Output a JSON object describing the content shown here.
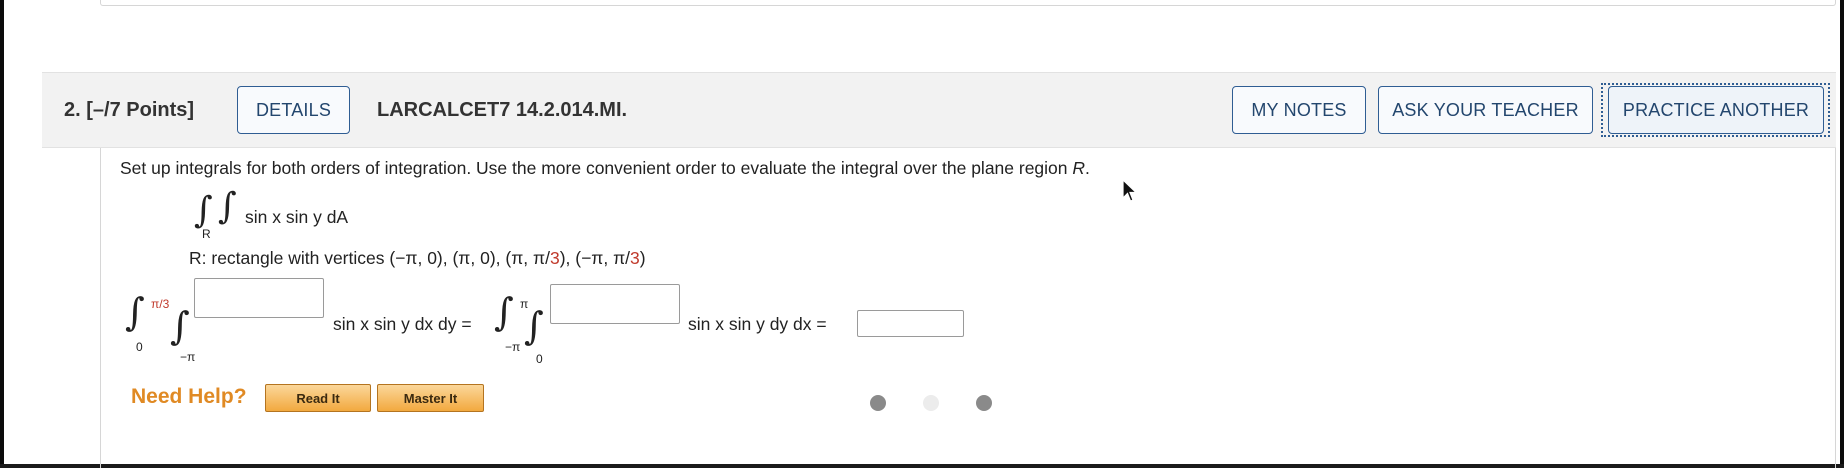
{
  "question": {
    "number_label": "2. [–/7 Points]",
    "details_label": "DETAILS",
    "code": "LARCALCET7 14.2.014.MI.",
    "my_notes_label": "MY NOTES",
    "ask_teacher_label": "ASK YOUR TEACHER",
    "practice_label": "PRACTICE ANOTHER"
  },
  "problem": {
    "instructions_main": "Set up integrals for both orders of integration. Use the more convenient order to evaluate the integral over the plane region ",
    "instructions_var": "R",
    "instructions_end": ".",
    "integral_sub": "R",
    "integrand": "sin x sin y dA",
    "region_prefix": "R: rectangle with vertices (−π, 0), (π, 0), (π, π/",
    "region_3a": "3",
    "region_mid": "), (−π, π/",
    "region_3b": "3",
    "region_end": ")"
  },
  "equation": {
    "outer1_upper": "π/3",
    "outer1_lower": "0",
    "inner1_lower": "−π",
    "integrand1": "sin x sin y dx dy =",
    "outer2_upper": "π",
    "outer2_lower": "−π",
    "inner2_lower": "0",
    "integrand2": "sin x sin y dy dx =",
    "inner1_upper_value": "",
    "inner2_upper_value": "",
    "answer_value": ""
  },
  "help": {
    "label": "Need Help?",
    "read_it": "Read It",
    "master_it": "Master It"
  },
  "colors": {
    "accent_blue": "#2f5d93",
    "header_bg": "#f2f2f2",
    "help_orange": "#e08a24",
    "red_highlight": "#c0392b"
  },
  "icons": [
    "mouse-cursor-icon"
  ]
}
